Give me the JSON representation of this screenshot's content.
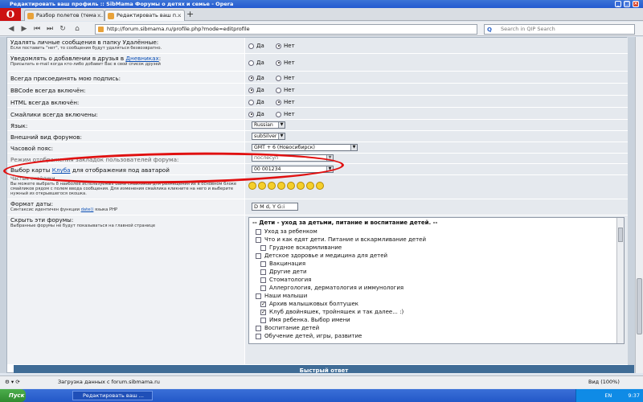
{
  "window": {
    "title": "Редактировать ваш профиль :: SibMama Форумы о детях и семье - Opera"
  },
  "tabs": [
    {
      "label": "Разбор полетов (тема ..."
    },
    {
      "label": "Редактировать ваш п..."
    }
  ],
  "newtab": "+",
  "browser": {
    "logo": "O",
    "url": "http://forum.sibmama.ru/profile.php?mode=editprofile",
    "search_placeholder": "Search in QIP Search"
  },
  "options": {
    "yes": "Да",
    "no": "Нет"
  },
  "form_rows": [
    {
      "label": "Удалять личные сообщения в папку Удалённые:",
      "sub": "Если поставить \"нет\", то сообщения будут удаляться безвозвратно.",
      "value": "no"
    },
    {
      "label_pre": "Уведомлять о добавлении в друзья в ",
      "label_link": "Дневниках",
      "label_post": ":",
      "sub": "Присылать e-mail когда кто-либо добавит Вас в свой список друзей",
      "value": "no"
    },
    {
      "label": "Всегда присоединять мою подпись:",
      "value": "yes"
    },
    {
      "label": "BBCode всегда включён:",
      "value": "yes"
    },
    {
      "label": "HTML всегда включён:",
      "value": "no"
    },
    {
      "label": "Смайлики всегда включены:",
      "value": "yes"
    }
  ],
  "language": {
    "label": "Язык:",
    "value": "Russian"
  },
  "style": {
    "label": "Внешний вид форумов:",
    "value": "subSilver"
  },
  "timezone": {
    "label": "Часовой пояс:",
    "value": "GMT + 6 (Новосибирск)"
  },
  "hidden_row": {
    "label": "Режим отображения закладок пользователей форума:",
    "value": "послесуп"
  },
  "club_card": {
    "label_pre": "Выбор карты ",
    "label_link": "Клуба",
    "label_post": " для отображения под аватарой",
    "value": "00 001234"
  },
  "smileys": {
    "label": "Частые смайлики",
    "sub": "Вы можете выбрать 8 наиболее используемых Вами смайликов для размещения их в основном блоке смайликов рядом с полем ввода сообщения. Для изменения смайлика кликните на него и выберите нужный из открывшегося окошка."
  },
  "date_format": {
    "label": "Формат даты:",
    "sub_pre": "Синтаксис идентичен функции ",
    "sub_link": "date()",
    "sub_post": " языка PHP",
    "value": "D M d, Y G:i"
  },
  "hide_forums": {
    "label": "Скрыть эти форумы:",
    "sub": "Выбранные форумы не будут показываться на главной странице"
  },
  "forum_list": [
    {
      "label": "-- Дети - уход за детьми, питание и воспитание детей. --",
      "type": "header"
    },
    {
      "label": "Уход за ребенком",
      "level": 1,
      "checked": false
    },
    {
      "label": "Что и как едят дети. Питание и вскармливание детей",
      "level": 1,
      "checked": false
    },
    {
      "label": "Грудное вскармливание",
      "level": 2,
      "checked": false
    },
    {
      "label": "Детское здоровье и медицина для детей",
      "level": 1,
      "checked": false
    },
    {
      "label": "Вакцинация",
      "level": 2,
      "checked": false
    },
    {
      "label": "Другие дети",
      "level": 2,
      "checked": false
    },
    {
      "label": "Стоматология",
      "level": 2,
      "checked": false
    },
    {
      "label": "Аллергология, дерматология и иммунология",
      "level": 2,
      "checked": false
    },
    {
      "label": "Наши малыши",
      "level": 1,
      "checked": false
    },
    {
      "label": "Архив малышковых болтушек",
      "level": 2,
      "checked": true
    },
    {
      "label": "Клуб двойняшек, тройняшек и так далее... :)",
      "level": 2,
      "checked": true
    },
    {
      "label": "Имя ребенка. Выбор имени",
      "level": 2,
      "checked": false
    },
    {
      "label": "Воспитание детей",
      "level": 1,
      "checked": false
    },
    {
      "label": "Обучение детей, игры, развитие",
      "level": 1,
      "checked": false
    }
  ],
  "quick_reply": "Быстрый ответ",
  "status": {
    "text": "Загрузка данных с forum.sibmama.ru",
    "zoom": "Вид (100%)"
  },
  "taskbar": {
    "start": "Пуск",
    "item": "Редактировать ваш ...",
    "clock": "9:37",
    "lang": "EN"
  }
}
